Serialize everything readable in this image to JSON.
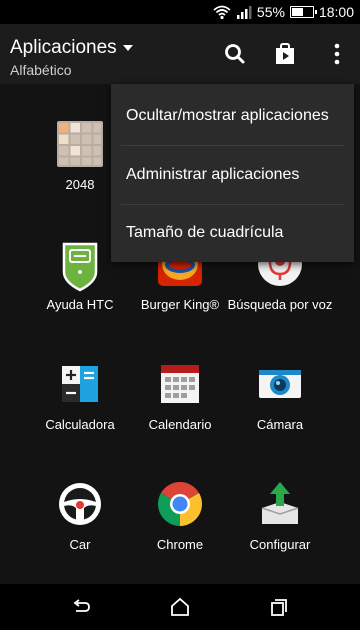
{
  "status_bar": {
    "battery_percent": "55%",
    "battery_level": 0.55,
    "time": "18:00"
  },
  "action_bar": {
    "title": "Aplicaciones",
    "subtitle": "Alfabético",
    "icons": [
      "search-icon",
      "store-bag-icon",
      "overflow-menu-icon"
    ]
  },
  "apps": [
    {
      "name": "2048",
      "icon": "game-2048-icon"
    },
    {
      "name": "Ayuda HTC",
      "icon": "htc-help-icon"
    },
    {
      "name": "Burger King®",
      "icon": "burger-king-icon"
    },
    {
      "name": "Búsqueda por voz",
      "icon": "voice-search-icon"
    },
    {
      "name": "Calculadora",
      "icon": "calculator-icon"
    },
    {
      "name": "Calendario",
      "icon": "calendar-icon"
    },
    {
      "name": "Cámara",
      "icon": "camera-icon"
    },
    {
      "name": "Car",
      "icon": "steering-wheel-icon"
    },
    {
      "name": "Chrome",
      "icon": "chrome-icon"
    },
    {
      "name": "Configurar",
      "icon": "setup-box-icon"
    }
  ],
  "menu": {
    "items": [
      {
        "label": "Ocultar/mostrar aplicaciones"
      },
      {
        "label": "Administrar aplicaciones"
      },
      {
        "label": "Tamaño de cuadrícula"
      }
    ]
  },
  "nav_bar": {
    "icons": [
      "back-icon",
      "home-icon",
      "recents-icon"
    ]
  },
  "colors": {
    "background": "#131313",
    "action_bar": "#1c1c1c",
    "menu": "#2b2b2b",
    "htc_green": "#6db33f",
    "camera_blue": "#1e88c8",
    "setup_green": "#2aa84a"
  }
}
